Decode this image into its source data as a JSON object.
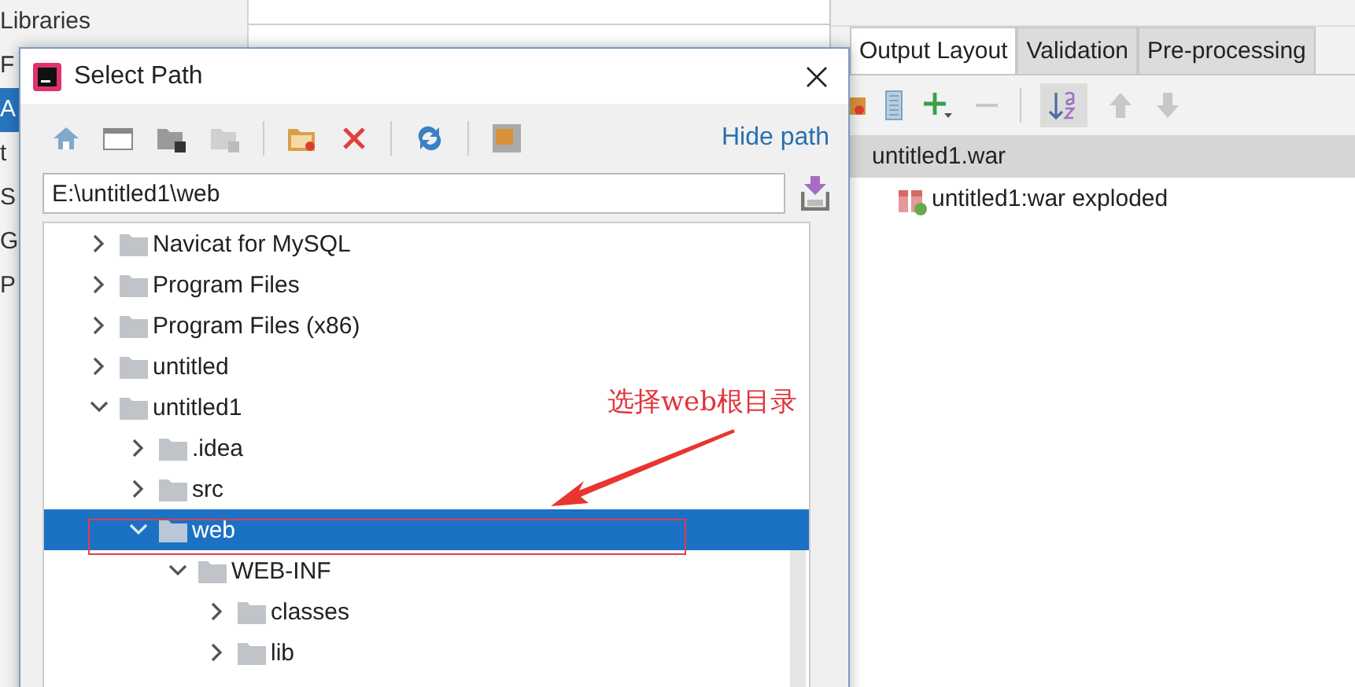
{
  "sidebar": {
    "items": [
      {
        "label": "Libraries",
        "selected": false
      },
      {
        "label": "F",
        "selected": false
      },
      {
        "label": "A",
        "selected": true
      },
      {
        "label": "t",
        "selected": false
      },
      {
        "label": "S",
        "selected": false
      },
      {
        "label": "G",
        "selected": false
      },
      {
        "label": "P",
        "selected": false
      }
    ]
  },
  "artifact_panel": {
    "tabs": [
      {
        "label": "Output Layout",
        "selected": true
      },
      {
        "label": "Validation",
        "selected": false
      },
      {
        "label": "Pre-processing",
        "selected": false
      }
    ],
    "tree": [
      {
        "label": "untitled1.war",
        "selected": true,
        "children": [
          {
            "label": "untitled1:war exploded",
            "selected": false
          }
        ]
      }
    ]
  },
  "dialog": {
    "title": "Select Path",
    "hide_path_link": "Hide path",
    "path": "E:\\untitled1\\web",
    "tree": [
      {
        "label": "Navicat for MySQL",
        "expanded": false,
        "selected": false
      },
      {
        "label": "Program Files",
        "expanded": false,
        "selected": false
      },
      {
        "label": "Program Files (x86)",
        "expanded": false,
        "selected": false
      },
      {
        "label": "untitled",
        "expanded": false,
        "selected": false
      },
      {
        "label": "untitled1",
        "expanded": true,
        "selected": false,
        "children": [
          {
            "label": ".idea",
            "expanded": false,
            "selected": false
          },
          {
            "label": "src",
            "expanded": false,
            "selected": false
          },
          {
            "label": "web",
            "expanded": true,
            "selected": true,
            "children": [
              {
                "label": "WEB-INF",
                "expanded": true,
                "selected": false,
                "children": [
                  {
                    "label": "classes",
                    "expanded": false,
                    "selected": false
                  },
                  {
                    "label": "lib",
                    "expanded": false,
                    "selected": false
                  }
                ]
              }
            ]
          }
        ]
      }
    ]
  },
  "annotation": {
    "text": "选择web根目录"
  }
}
